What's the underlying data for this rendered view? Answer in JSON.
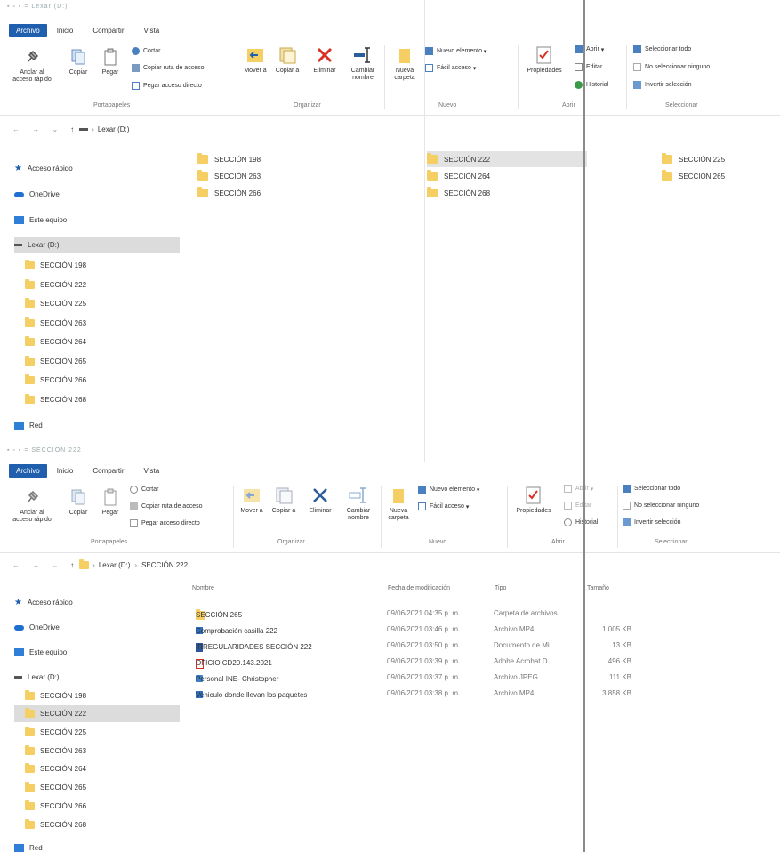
{
  "window1": {
    "title": "Lexar (D:)",
    "tabs": [
      "Archivo",
      "Inicio",
      "Compartir",
      "Vista"
    ],
    "ribbon": {
      "anclar": "Anclar al acceso rápido",
      "copiar": "Copiar",
      "pegar": "Pegar",
      "cortar": "Cortar",
      "copiar_ruta": "Copiar ruta de acceso",
      "pegar_acceso": "Pegar acceso directo",
      "mover": "Mover a",
      "copiar_a": "Copiar a",
      "eliminar": "Eliminar",
      "cambiar_nombre": "Cambiar nombre",
      "nueva_carpeta": "Nueva carpeta",
      "nuevo_elemento": "Nuevo elemento",
      "facil_acceso": "Fácil acceso",
      "propiedades": "Propiedades",
      "abrir": "Abrir",
      "editar": "Editar",
      "historial": "Historial",
      "seleccionar_todo": "Seleccionar todo",
      "no_seleccionar": "No seleccionar ninguno",
      "invertir": "Invertir selección",
      "groups": {
        "portapapeles": "Portapapeles",
        "organizar": "Organizar",
        "nuevo": "Nuevo",
        "abrir": "Abrir",
        "seleccionar": "Seleccionar"
      }
    },
    "address": {
      "path": "Lexar (D:)"
    },
    "nav": {
      "acceso_rapido": "Acceso rápido",
      "onedrive": "OneDrive",
      "este_equipo": "Este equipo",
      "lexar": "Lexar (D:)",
      "folders": [
        "SECCIÓN 198",
        "SECCIÓN 222",
        "SECCIÓN 225",
        "SECCIÓN 263",
        "SECCIÓN 264",
        "SECCIÓN 265",
        "SECCIÓN 266",
        "SECCIÓN 268"
      ],
      "red": "Red"
    },
    "content": {
      "col1": [
        "SECCIÓN 198",
        "SECCIÓN 263",
        "SECCIÓN 266"
      ],
      "col2": [
        "SECCIÓN 222",
        "SECCIÓN 264",
        "SECCIÓN 268"
      ],
      "col3": [
        "SECCIÓN 225",
        "SECCIÓN 265"
      ]
    }
  },
  "window2": {
    "title": "SECCIÓN 222",
    "tabs": [
      "Archivo",
      "Inicio",
      "Compartir",
      "Vista"
    ],
    "ribbon": {
      "anclar": "Anclar al acceso rápido",
      "copiar": "Copiar",
      "pegar": "Pegar",
      "cortar": "Cortar",
      "copiar_ruta": "Copiar ruta de acceso",
      "pegar_acceso": "Pegar acceso directo",
      "mover": "Mover a",
      "copiar_a": "Copiar a",
      "eliminar": "Eliminar",
      "cambiar_nombre": "Cambiar nombre",
      "nueva_carpeta": "Nueva carpeta",
      "nuevo_elemento": "Nuevo elemento",
      "facil_acceso": "Fácil acceso",
      "propiedades": "Propiedades",
      "abrir": "Abrir",
      "editar": "Editar",
      "historial": "Historial",
      "seleccionar_todo": "Seleccionar todo",
      "no_seleccionar": "No seleccionar ninguno",
      "invertir": "Invertir selección",
      "groups": {
        "portapapeles": "Portapapeles",
        "organizar": "Organizar",
        "nuevo": "Nuevo",
        "abrir": "Abrir",
        "seleccionar": "Seleccionar"
      }
    },
    "address": {
      "part1": "Lexar (D:)",
      "part2": "SECCIÓN 222"
    },
    "nav": {
      "acceso_rapido": "Acceso rápido",
      "onedrive": "OneDrive",
      "este_equipo": "Este equipo",
      "lexar": "Lexar (D:)",
      "folders": [
        "SECCIÓN 198",
        "SECCIÓN 222",
        "SECCIÓN 225",
        "SECCIÓN 263",
        "SECCIÓN 264",
        "SECCIÓN 265",
        "SECCIÓN 266",
        "SECCIÓN 268"
      ],
      "red": "Red"
    },
    "columns": {
      "nombre": "Nombre",
      "fecha": "Fecha de modificación",
      "tipo": "Tipo",
      "tamano": "Tamaño"
    },
    "files": [
      {
        "name": "SECCIÓN 265",
        "date": "09/06/2021 04:35 p. m.",
        "type": "Carpeta de archivos",
        "size": "",
        "icon": "folder-icon"
      },
      {
        "name": "Comprobación casilla 222",
        "date": "09/06/2021 03:46 p. m.",
        "type": "Archivo MP4",
        "size": "1 005 KB",
        "icon": "video-icon"
      },
      {
        "name": "IRREGULARIDADES SECCIÓN 222",
        "date": "09/06/2021 03:50 p. m.",
        "type": "Documento de Mi...",
        "size": "13 KB",
        "icon": "word-icon"
      },
      {
        "name": "OFICIO CD20.143.2021",
        "date": "09/06/2021 03:39 p. m.",
        "type": "Adobe Acrobat D...",
        "size": "496 KB",
        "icon": "pdf-icon"
      },
      {
        "name": "Personal INE- Christopher",
        "date": "09/06/2021 03:37 p. m.",
        "type": "Archivo JPEG",
        "size": "111 KB",
        "icon": "image-icon"
      },
      {
        "name": "Vehiculo donde llevan los paquetes",
        "date": "09/06/2021 03:38 p. m.",
        "type": "Archivo MP4",
        "size": "3 858 KB",
        "icon": "video-icon"
      }
    ]
  },
  "colors": {
    "accent": "#1f5fae",
    "folder": "#f5cf63",
    "selection": "#dcdcdc"
  }
}
